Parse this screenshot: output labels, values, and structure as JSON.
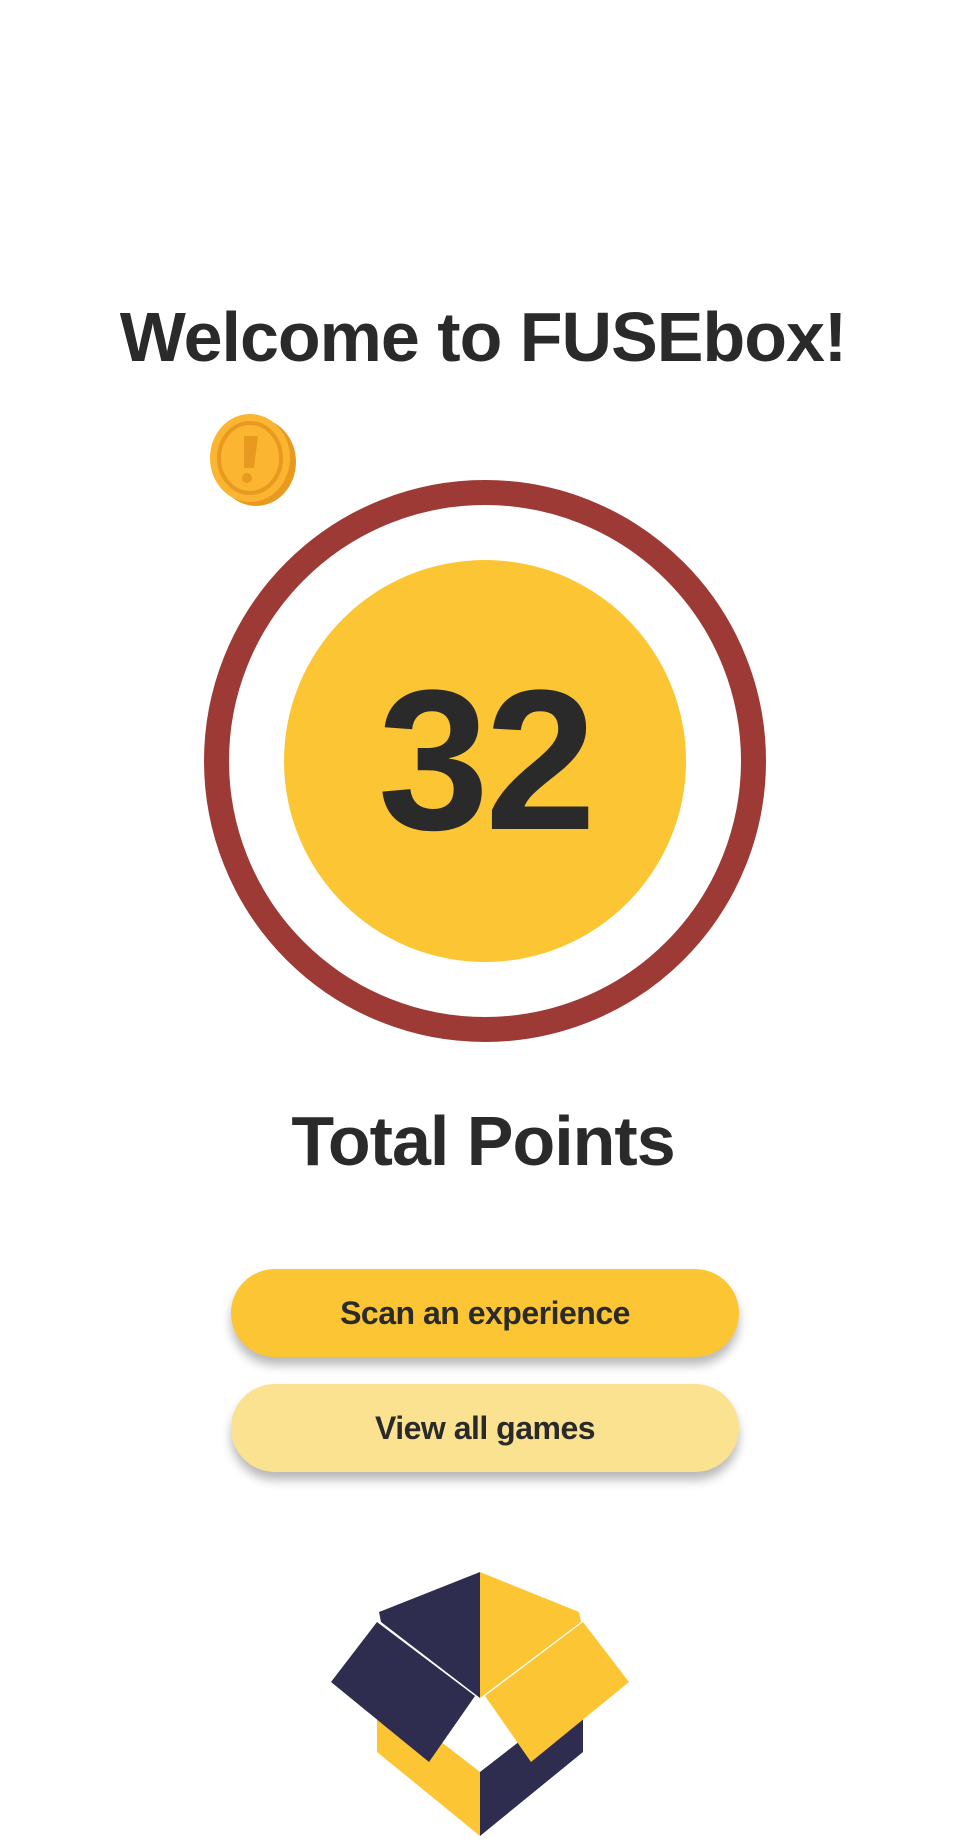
{
  "header": {
    "title": "Welcome to FUSEbox!"
  },
  "points": {
    "value": "32",
    "label": "Total Points"
  },
  "actions": {
    "scan_label": "Scan an experience",
    "games_label": "View all games"
  },
  "icons": {
    "coin": "coin-icon",
    "logo": "fusebox-logo"
  },
  "colors": {
    "primary_yellow": "#fcc533",
    "light_yellow": "#fae291",
    "ring_red": "#9e3a35",
    "navy": "#2e2c4f",
    "text": "#2a2a2a"
  }
}
